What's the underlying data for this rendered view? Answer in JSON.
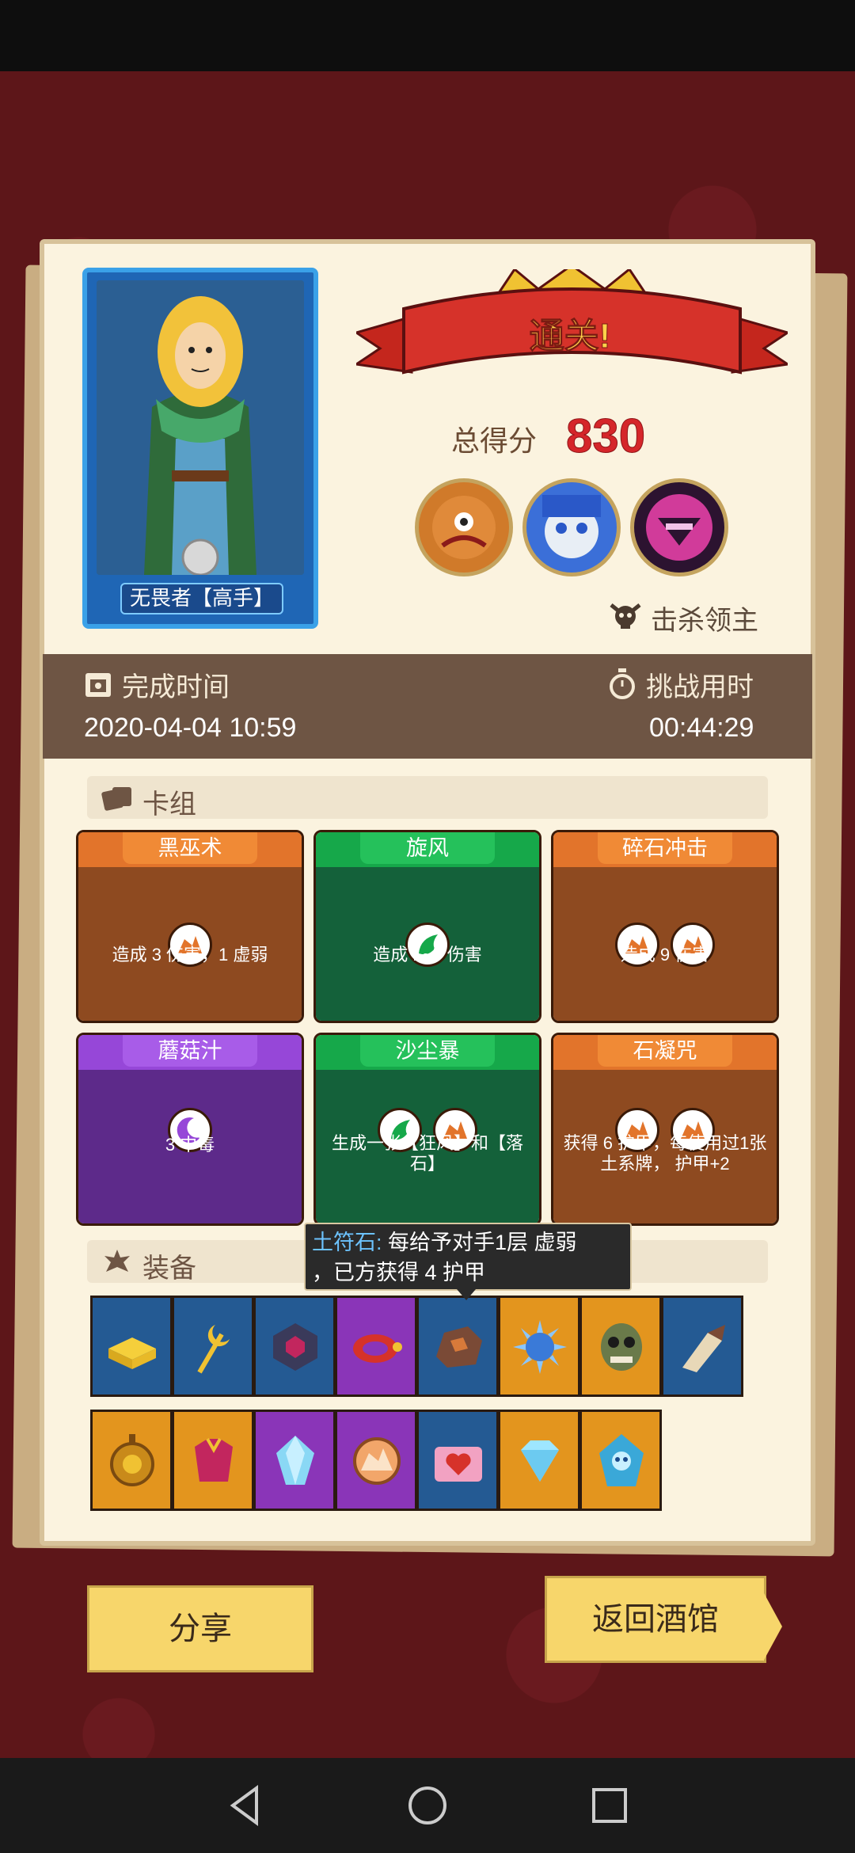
{
  "hero": {
    "name": "无畏者【高手】"
  },
  "result": {
    "banner": "通关!",
    "score_label": "总得分",
    "score": "830",
    "kill_label": "击杀领主"
  },
  "stats": {
    "finish_label": "完成时间",
    "finish_value": "2020-04-04 10:59",
    "duration_label": "挑战用时",
    "duration_value": "00:44:29"
  },
  "deck": {
    "title": "卡组",
    "cards": [
      {
        "name": "黑巫术",
        "color": "orange",
        "desc": "造成 3 伤害，1 虚弱"
      },
      {
        "name": "旋风",
        "color": "green",
        "desc": "造成 1~5 伤害"
      },
      {
        "name": "碎石冲击",
        "color": "orange",
        "desc": "造成 9 伤害"
      },
      {
        "name": "蘑菇汁",
        "color": "purple",
        "desc": "3 中毒"
      },
      {
        "name": "沙尘暴",
        "color": "green",
        "desc": "生成一张【狂风】和【落石】"
      },
      {
        "name": "石凝咒",
        "color": "orange",
        "desc": "获得 6 护甲，每使用过1张 土系牌， 护甲+2"
      }
    ]
  },
  "equipment": {
    "title": "装备",
    "tooltip": {
      "name": "土符石:",
      "line1": "每给予对手1层 虚弱",
      "line2": "，已方获得 4 护甲"
    },
    "row1": [
      "blue",
      "blue",
      "blue",
      "purple",
      "blue",
      "orange",
      "orange",
      "blue"
    ],
    "row2": [
      "orange",
      "orange",
      "purple",
      "purple",
      "blue",
      "orange",
      "orange"
    ]
  },
  "buttons": {
    "share": "分享",
    "return": "返回酒馆"
  },
  "icons": [
    "back-icon",
    "home-icon",
    "recent-apps-icon",
    "calendar-icon",
    "stopwatch-icon",
    "skull-icon",
    "cards-icon",
    "gear-icon"
  ]
}
